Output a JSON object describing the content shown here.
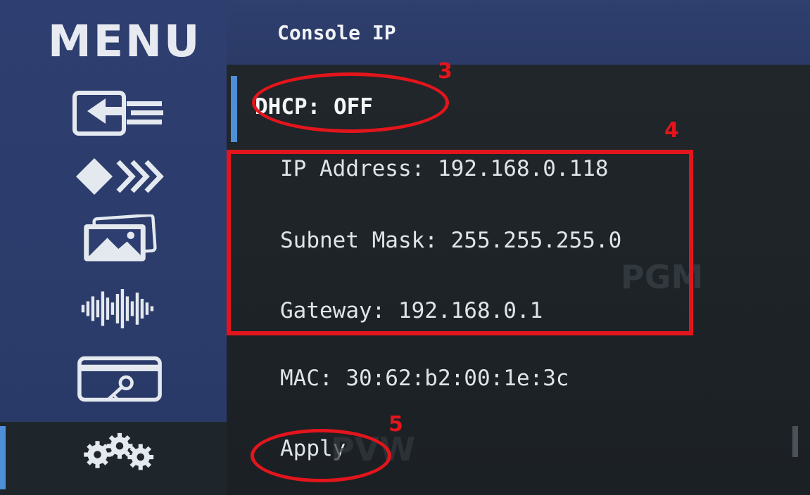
{
  "sidebar": {
    "title": "MENU",
    "items": [
      {
        "icon": "input-source-icon"
      },
      {
        "icon": "transition-icon"
      },
      {
        "icon": "media-image-icon"
      },
      {
        "icon": "audio-waveform-icon"
      },
      {
        "icon": "key-card-icon"
      },
      {
        "icon": "settings-gears-icon",
        "selected": true
      }
    ]
  },
  "header": {
    "title": "Console IP"
  },
  "settings": {
    "dhcp": "DHCP: OFF",
    "ip_address": "IP Address: 192.168.0.118",
    "subnet_mask": "Subnet Mask: 255.255.255.0",
    "gateway": "Gateway: 192.168.0.1",
    "mac": "MAC: 30:62:b2:00:1e:3c",
    "apply": "Apply"
  },
  "background_text": {
    "pgm": "PGM",
    "pvw": "PVW"
  },
  "annotations": {
    "label_3": "3",
    "label_4": "4",
    "label_5": "5",
    "color": "#e3151c"
  },
  "colors": {
    "accent": "#4f8fd6",
    "sidebar_bg": "#2e3e70",
    "content_bg": "#1c2125"
  }
}
